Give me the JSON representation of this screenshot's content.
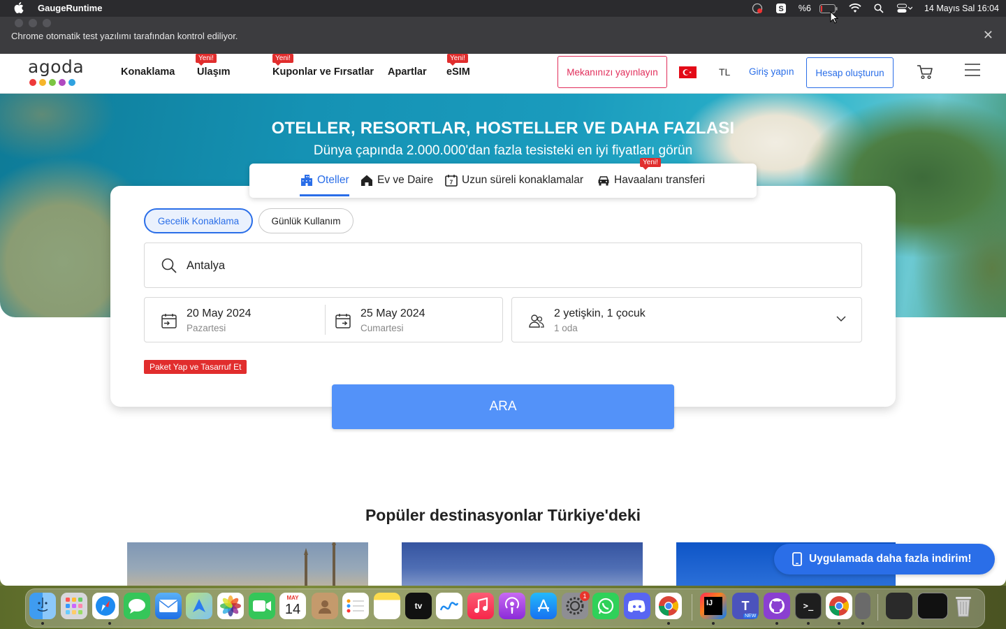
{
  "menubar": {
    "app_name": "GaugeRuntime",
    "battery": "%6",
    "datetime": "14 Mayıs Sal  16:04"
  },
  "infobar": {
    "message": "Chrome otomatik test yazılımı tarafından kontrol ediliyor."
  },
  "header": {
    "logo_text": "agoda",
    "logo_dot_colors": [
      "#ee3a3a",
      "#f6b52b",
      "#7cc543",
      "#b04ac0",
      "#30a2e0"
    ],
    "nav": [
      {
        "label": "Konaklama",
        "badge": ""
      },
      {
        "label": "Ulaşım",
        "badge": "Yeni!"
      },
      {
        "label": "Kuponlar ve Fırsatlar",
        "badge": "Yeni!"
      },
      {
        "label": "Apartlar",
        "badge": ""
      },
      {
        "label": "eSIM",
        "badge": "Yeni!"
      }
    ],
    "list_property": "Mekanınızı yayınlayın",
    "currency": "TL",
    "login": "Giriş yapın",
    "signup": "Hesap oluşturun"
  },
  "hero": {
    "title": "OTELLER, RESORTLAR, HOSTELLER VE DAHA FAZLASI",
    "subtitle": "Dünya çapında 2.000.000'dan fazla tesisteki en iyi fiyatları görün"
  },
  "tabs": [
    {
      "label": "Oteller",
      "active": true,
      "icon": "hotel-icon"
    },
    {
      "label": "Ev ve Daire",
      "active": false,
      "icon": "home-icon"
    },
    {
      "label": "Uzun süreli konaklamalar",
      "active": false,
      "icon": "calendar-7-icon"
    },
    {
      "label": "Havaalanı transferi",
      "active": false,
      "icon": "car-icon",
      "badge": "Yeni!"
    }
  ],
  "search": {
    "stay_types": [
      "Gecelik Konaklama",
      "Günlük Kullanım"
    ],
    "destination": "Antalya",
    "checkin": {
      "date": "20 May 2024",
      "day": "Pazartesi"
    },
    "checkout": {
      "date": "25 May 2024",
      "day": "Cumartesi"
    },
    "guests": {
      "summary": "2 yetişkin, 1 çocuk",
      "rooms": "1 oda"
    },
    "promo": "Paket Yap ve Tasarruf Et",
    "submit": "ARA"
  },
  "popular": {
    "title": "Popüler destinasyonlar Türkiye'deki"
  },
  "app_banner": "Uygulamada daha fazla indirim!",
  "dock": {
    "calendar_month": "MAY",
    "calendar_day": "14",
    "settings_badge": "1",
    "teams_badge": "NEW"
  },
  "colors": {
    "accent": "#2a6ee8",
    "search_button": "#5392f9",
    "promo_red": "#e12d2d",
    "list_property_border": "#e12d5a"
  }
}
